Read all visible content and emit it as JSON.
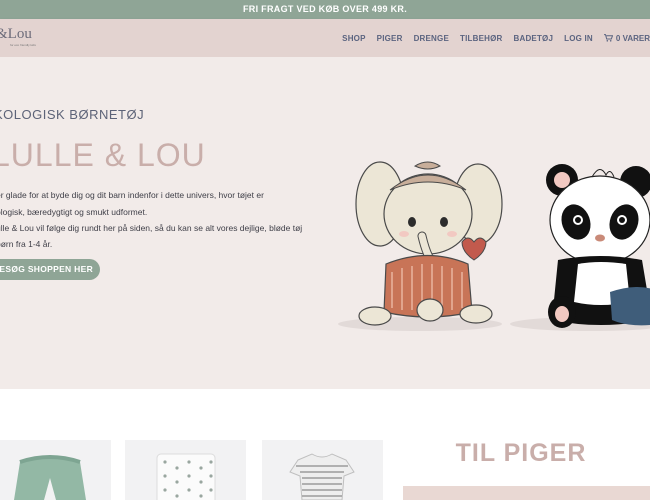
{
  "announcement": "FRI FRAGT VED KØB OVER 499 KR.",
  "logo": {
    "text": "&Lou",
    "tagline": "for eco friendly kids"
  },
  "nav": {
    "items": [
      "SHOP",
      "PIGER",
      "DRENGE",
      "TILBEHØR",
      "BADETØJ",
      "LOG IN"
    ],
    "cart_label": "0 VARER"
  },
  "hero": {
    "eyebrow": "KOLOGISK BØRNETØJ",
    "title": "LULLE & LOU",
    "paragraph1_line1": "er glade for at byde dig og dit barn indenfor i dette univers, hvor tøjet er",
    "paragraph1_line2": "ologisk, bæredygtigt og smukt udformet.",
    "paragraph2_line1": "ulle & Lou vil følge dig rundt her på siden, så du kan se alt vores dejlige, bløde tøj",
    "paragraph2_line2": "børn fra 1-4 år.",
    "cta": "BESØG SHOPPEN HER"
  },
  "section": {
    "title": "TIL PIGER"
  },
  "colors": {
    "accent": "#8fa596",
    "header_bg": "#e3d3d0",
    "hero_bg": "#f2ebe9",
    "title_pink": "#c9aeaa",
    "nav_text": "#5b6480"
  }
}
